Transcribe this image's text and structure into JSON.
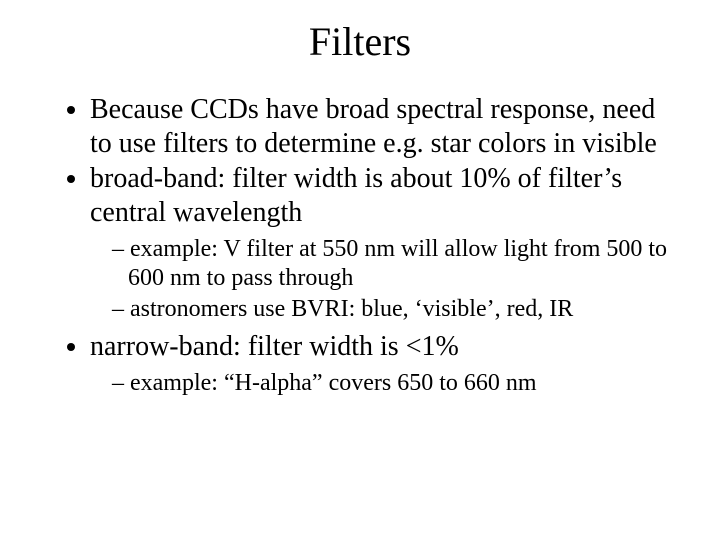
{
  "title": "Filters",
  "bullets": {
    "b1": "Because CCDs have broad spectral response, need to use filters to determine e.g. star colors in visible",
    "b2": "broad-band: filter width is about 10% of filter’s central wavelength",
    "b2_subs": {
      "s1": "example: V filter at 550 nm will allow light from 500 to 600 nm to pass through",
      "s2": "astronomers use BVRI: blue, ‘visible’, red, IR"
    },
    "b3": "narrow-band: filter width is <1%",
    "b3_subs": {
      "s1": "example: “H-alpha” covers 650 to 660 nm"
    }
  }
}
